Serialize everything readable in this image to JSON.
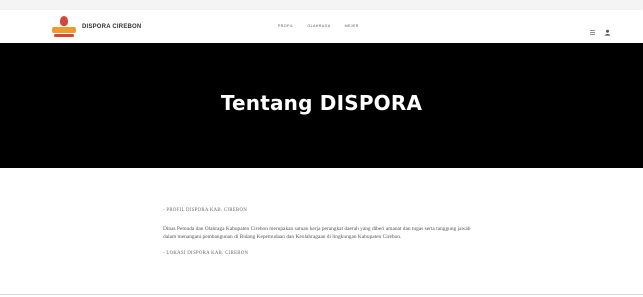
{
  "navbar": {
    "brand": "DISPORA CIREBON",
    "links": [
      "Profil",
      "Olahraga",
      "Mejer"
    ],
    "icons": [
      "menu-icon",
      "user-icon"
    ]
  },
  "hero": {
    "title": "Tentang DISPORA"
  },
  "content": {
    "section1_heading": "- PROFIL DISPORA KAB. CIREBON",
    "section1_text": "Dinas Pemuda dan Olahraga Kabupaten Cirebon merupakan satuan kerja perangkat daerah yang diberi amanat dan tugas serta tanggung jawab dalam menangani pembangunan di Bidang Kepemudaan dan Keolahragaan di lingkungan Kabupaten Cirebon.",
    "section2_heading": "- LOKASI DISPORA KAB. CIREBON"
  },
  "colors": {
    "hero_bg": "#000000",
    "hero_text": "#ffffff",
    "logo_red": "#d6453d",
    "logo_orange": "#f09a2c"
  }
}
